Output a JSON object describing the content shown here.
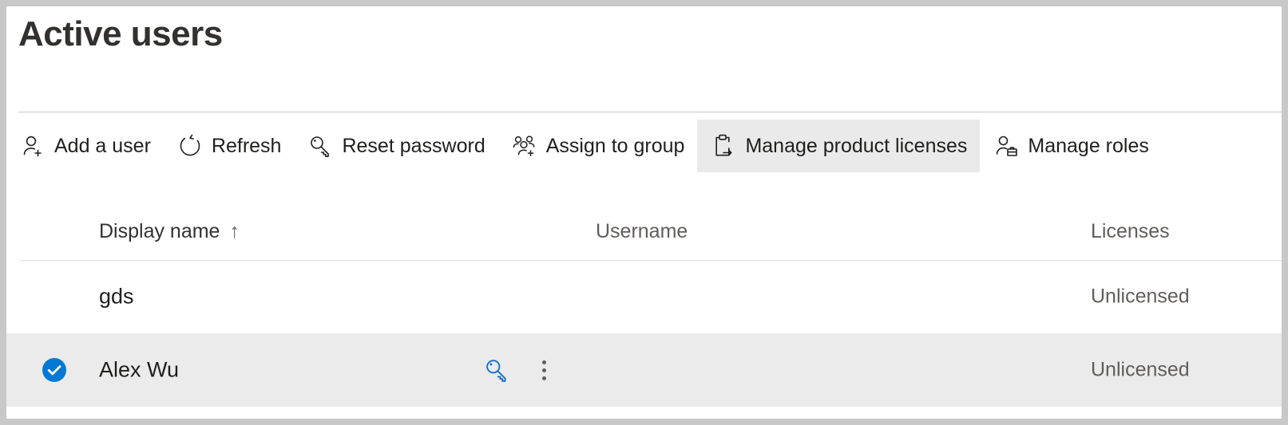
{
  "page": {
    "title": "Active users"
  },
  "colors": {
    "accent": "#0078d4",
    "title_text": "#323130",
    "secondary_text": "#605e5c",
    "highlight_bg": "#eaeaea",
    "selected_row_bg": "#ebebeb",
    "divider": "#c8c6c4",
    "frame_border": "#c8c8c8"
  },
  "toolbar": {
    "buttons": [
      {
        "label": "Add a user",
        "icon": "add-user-icon",
        "highlighted": false
      },
      {
        "label": "Refresh",
        "icon": "refresh-icon",
        "highlighted": false
      },
      {
        "label": "Reset password",
        "icon": "key-icon",
        "highlighted": false
      },
      {
        "label": "Assign to group",
        "icon": "add-people-icon",
        "highlighted": false
      },
      {
        "label": "Manage product licenses",
        "icon": "clipboard-arrow-icon",
        "highlighted": true
      },
      {
        "label": "Manage roles",
        "icon": "user-briefcase-icon",
        "highlighted": false
      }
    ]
  },
  "table": {
    "columns": {
      "display_name": "Display name",
      "sort_indicator": "↑",
      "username": "Username",
      "licenses": "Licenses"
    },
    "rows": [
      {
        "display_name": "gds",
        "username": "",
        "licenses": "Unlicensed",
        "selected": false,
        "show_row_actions": false
      },
      {
        "display_name": "Alex Wu",
        "username": "",
        "licenses": "Unlicensed",
        "selected": true,
        "show_row_actions": true,
        "actions": {
          "reset_password": "reset-password-key-icon",
          "more": "more-options-icon"
        }
      }
    ]
  }
}
